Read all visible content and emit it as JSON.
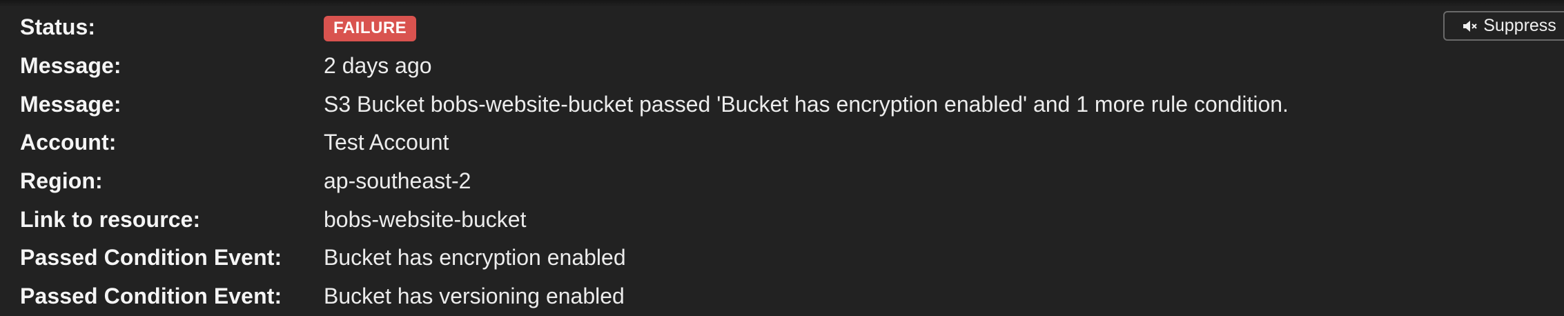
{
  "details": {
    "status": {
      "label": "Status:",
      "value": "FAILURE",
      "badge_color": "#d9534f"
    },
    "message_time": {
      "label": "Message:",
      "value": "2 days ago"
    },
    "message_text": {
      "label": "Message:",
      "value": "S3 Bucket bobs-website-bucket passed 'Bucket has encryption enabled' and 1 more rule condition."
    },
    "account": {
      "label": "Account:",
      "value": "Test Account"
    },
    "region": {
      "label": "Region:",
      "value": "ap-southeast-2"
    },
    "resource_link": {
      "label": "Link to resource:",
      "value": "bobs-website-bucket"
    },
    "passed_condition_1": {
      "label": "Passed Condition Event:",
      "value": "Bucket has encryption enabled"
    },
    "passed_condition_2": {
      "label": "Passed Condition Event:",
      "value": "Bucket has versioning enabled"
    }
  },
  "actions": {
    "suppress_label": "Suppress",
    "suppress_icon": "speaker-muted-icon"
  },
  "colors": {
    "background": "#222222",
    "failure": "#d9534f"
  }
}
